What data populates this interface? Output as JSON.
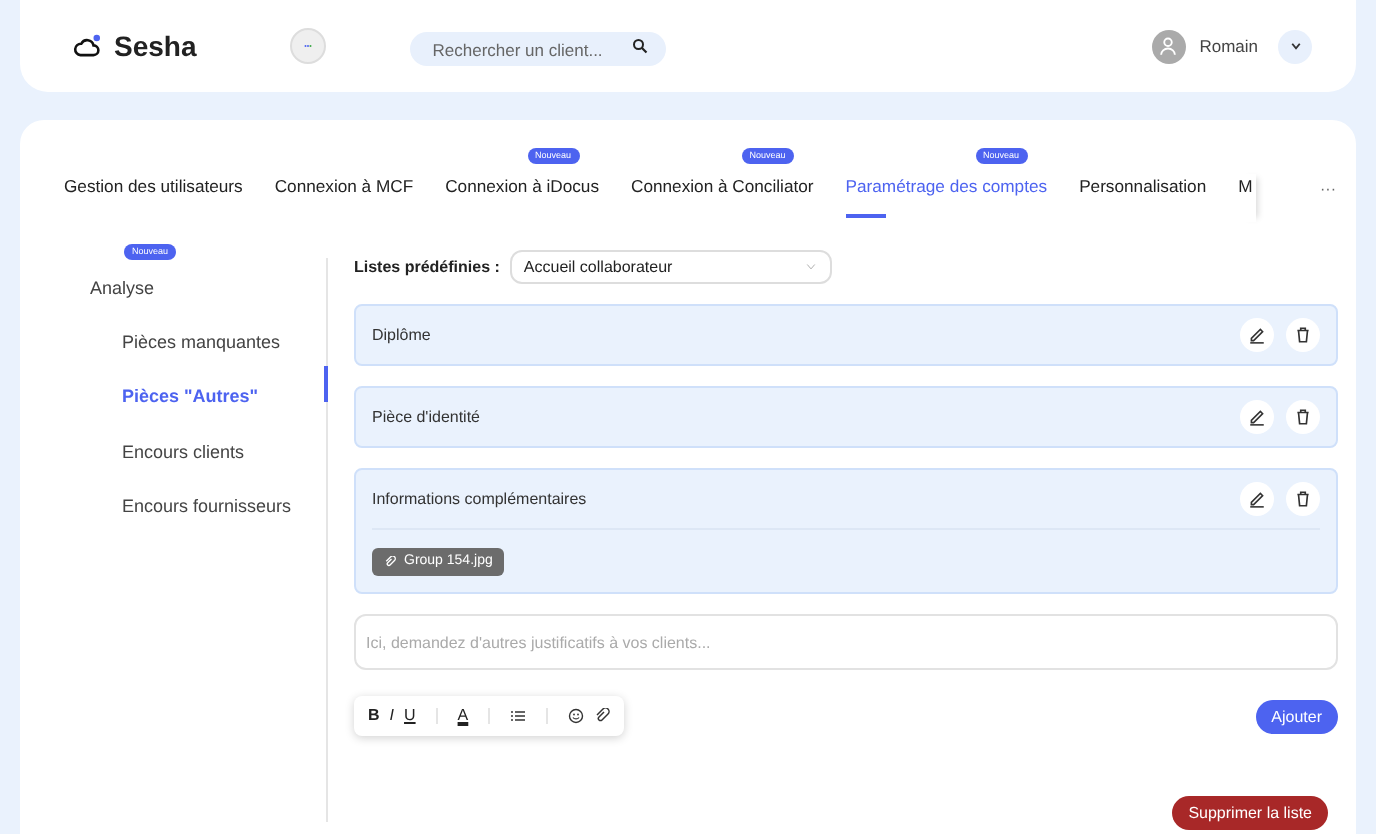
{
  "header": {
    "brand": "Sesha",
    "search": {
      "placeholder": "Rechercher un client..."
    },
    "user": {
      "name": "Romain"
    }
  },
  "tabs": [
    {
      "label": "Gestion des utilisateurs",
      "selected": false
    },
    {
      "label": "Connexion à MCF",
      "selected": false
    },
    {
      "label": "Connexion à iDocus",
      "selected": false,
      "badge": "Nouveau"
    },
    {
      "label": "Connexion à Conciliator",
      "selected": false,
      "badge": "Nouveau"
    },
    {
      "label": "Paramétrage des comptes",
      "selected": true,
      "badge": "Nouveau"
    },
    {
      "label": "Personnalisation",
      "selected": false
    },
    {
      "label": "M",
      "selected": false
    }
  ],
  "tabs_more": "···",
  "sidebar": {
    "items": [
      {
        "label": "Analyse",
        "selected": false,
        "badge": "Nouveau"
      },
      {
        "label": "Pièces manquantes",
        "selected": false
      },
      {
        "label": "Pièces \"Autres\"",
        "selected": true
      },
      {
        "label": "Encours clients",
        "selected": false
      },
      {
        "label": "Encours fournisseurs",
        "selected": false
      }
    ]
  },
  "predefined": {
    "label": "Listes prédéfinies :",
    "value": "Accueil collaborateur"
  },
  "documents": [
    {
      "name": "Diplôme"
    },
    {
      "name": "Pièce d'identité"
    },
    {
      "name": "Informations complémentaires",
      "attachments": [
        "Group 154.jpg"
      ]
    }
  ],
  "editor": {
    "placeholder": "Ici, demandez d'autres justificatifs à vos clients...",
    "toolbar": [
      {
        "kind": "bold",
        "label": "B"
      },
      {
        "kind": "italic",
        "label": "I"
      },
      {
        "kind": "underline",
        "label": "U"
      },
      {
        "kind": "sep"
      },
      {
        "kind": "color",
        "label": "A"
      },
      {
        "kind": "sep"
      },
      {
        "kind": "list"
      },
      {
        "kind": "sep"
      },
      {
        "kind": "emoji"
      },
      {
        "kind": "attach"
      }
    ]
  },
  "add_button": "Ajouter",
  "delete_button": "Supprimer la liste"
}
